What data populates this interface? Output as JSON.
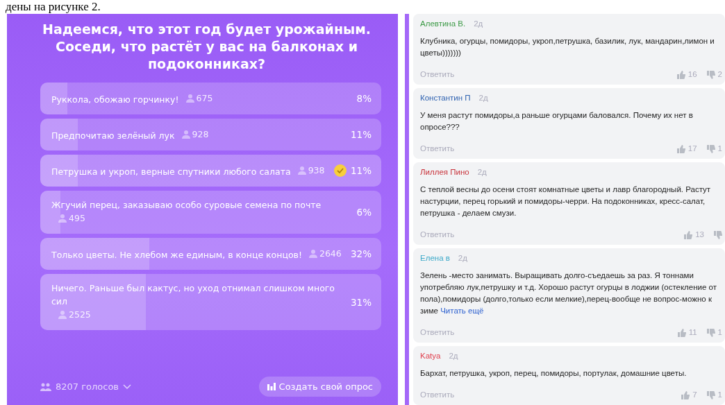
{
  "document_text": "дены на рисунке 2.",
  "poll": {
    "question": "Надеемся, что этот год будет урожайным. Соседи, что растёт у вас на балконах и подоконниках?",
    "options": [
      {
        "label": "Руккола, обожаю горчинку!",
        "votes": "675",
        "percent": "8%",
        "level": 0.08,
        "selected": false
      },
      {
        "label": "Предпочитаю зелёный лук",
        "votes": "928",
        "percent": "11%",
        "level": 0.11,
        "selected": false
      },
      {
        "label": "Петрушка и укроп, верные спутники любого салата",
        "votes": "938",
        "percent": "11%",
        "level": 0.11,
        "selected": true
      },
      {
        "label": "Жгучий перец, заказываю особо суровые семена по почте",
        "votes": "495",
        "percent": "6%",
        "level": 0.06,
        "selected": false
      },
      {
        "label": "Только цветы. Не хлебом же единым, в конце концов!",
        "votes": "2646",
        "percent": "32%",
        "level": 0.32,
        "selected": false
      },
      {
        "label": "Ничего. Раньше был кактус, но уход отнимал слишком много сил",
        "votes": "2525",
        "percent": "31%",
        "level": 0.31,
        "selected": false
      }
    ],
    "total_votes": "8207 голосов",
    "create_button": "Создать свой опрос"
  },
  "comments": [
    {
      "author": "Алевтина В.",
      "color": "#3c9a46",
      "time": "2д",
      "text": "Клубника, огурцы, помидоры, укроп,петрушка, базилик, лук, мандарин,лимон и цветы)))))))",
      "reply": "Ответить",
      "likes": "16",
      "dislikes": "2"
    },
    {
      "author": "Константин П",
      "color": "#2f62b0",
      "time": "2д",
      "text": "У меня растут помидоры,а раньше огурцами баловался. Почему их нет в опросе???",
      "reply": "Ответить",
      "likes": "17",
      "dislikes": "1"
    },
    {
      "author": "Лиллея Пино",
      "color": "#c8323a",
      "time": "2д",
      "text": "С теплой весны до осени стоят комнатные  цветы и лавр благородный. Растут настурции, перец горький и помидоры-черри. На подоконниках, кресс-салат, петрушка - делаем смузи.",
      "reply": "Ответить",
      "likes": "13"
    },
    {
      "author": "Елена в",
      "color": "#3aa8c8",
      "time": "2д",
      "text": "Зелень -место занимать. Выращивать долго-съедаешь за раз. Я тоннами употребляю лук,петрушку и т.д. Хорошо растут огурцы в лоджии (остекление от пола),помидоры (долго,только если мелкие),перец-вообще не вопрос-можно к зиме",
      "more": "Читать ещё",
      "reply": "Ответить",
      "likes": "11",
      "dislikes": "1"
    },
    {
      "author": "Katya",
      "color": "#e0404e",
      "time": "2д",
      "text": "Бархат, петрушка, укроп, перец, помидоры, портулак, домашние цветы.",
      "reply": "Ответить",
      "likes": "7",
      "dislikes": "1"
    }
  ]
}
